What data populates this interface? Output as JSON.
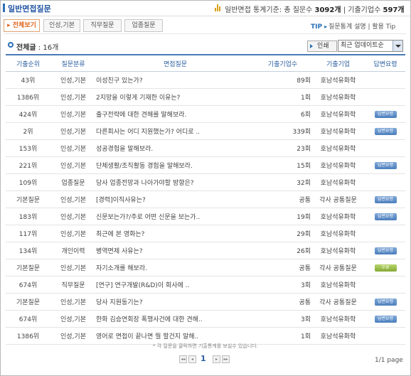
{
  "header": {
    "title": "일반면접질문",
    "stats_prefix": "일반면접 통계기준: 총 질문수",
    "total_questions": "3092개",
    "stats_mid": "| 기출기업수",
    "total_companies": "597개"
  },
  "tabs": [
    {
      "label": "전체보기",
      "active": true
    },
    {
      "label": "인성,기본",
      "active": false
    },
    {
      "label": "직무질문",
      "active": false
    },
    {
      "label": "업종질문",
      "active": false
    }
  ],
  "tip": {
    "label": "TIP",
    "text": "질문통계 설명 | 활용 Tip"
  },
  "total_label": "전체글",
  "total_count": ": 16개",
  "print_label": "인쇄",
  "sort_value": "최근 업데이트순",
  "columns": [
    "기출순위",
    "질문분류",
    "면접질문",
    "기출기업수",
    "기출기업",
    "답변요령"
  ],
  "rows": [
    {
      "rank": "43위",
      "category": "인성,기본",
      "question": "이성친구 있는가?",
      "count": "89회",
      "company": "호남석유화학",
      "answer": ""
    },
    {
      "rank": "1386위",
      "category": "인성,기본",
      "question": "2지망을 이렇게 기재한 이유는?",
      "count": "1회",
      "company": "호남석유화학",
      "answer": ""
    },
    {
      "rank": "424위",
      "category": "인성,기본",
      "question": "출구전략에 대한 견해를 말해보라.",
      "count": "6회",
      "company": "호남석유화학",
      "answer": "답변요령"
    },
    {
      "rank": "2위",
      "category": "인성,기본",
      "question": "다른회사는 어디 지원했는가? 어디로 ..",
      "count": "339회",
      "company": "호남석유화학",
      "answer": "답변요령"
    },
    {
      "rank": "153위",
      "category": "인성,기본",
      "question": "성공경험을 말해보라.",
      "count": "23회",
      "company": "호남석유화학",
      "answer": ""
    },
    {
      "rank": "221위",
      "category": "인성,기본",
      "question": "단체생활/조직활동 경험을 말해보라.",
      "count": "15회",
      "company": "호남석유화학",
      "answer": "답변요령"
    },
    {
      "rank": "109위",
      "category": "업종질문",
      "question": "당사 업종전망과 나아가야할 방향은?",
      "count": "32회",
      "company": "호남석유화학",
      "answer": ""
    },
    {
      "rank": "기본질문",
      "category": "인성,기본",
      "question": "[경력]이직사유는?",
      "count": "공통",
      "company": "각사 공통질문",
      "answer": "답변요령"
    },
    {
      "rank": "183위",
      "category": "인성,기본",
      "question": "신문보는가?/주로 어떤 신문을 보는가..",
      "count": "19회",
      "company": "호남석유화학",
      "answer": "답변요령"
    },
    {
      "rank": "117위",
      "category": "인성,기본",
      "question": "최근에 본 영화는?",
      "count": "29회",
      "company": "호남석유화학",
      "answer": ""
    },
    {
      "rank": "134위",
      "category": "개인이력",
      "question": "병역면제 사유는?",
      "count": "26회",
      "company": "호남석유화학",
      "answer": "답변요령"
    },
    {
      "rank": "기본질문",
      "category": "인성,기본",
      "question": "자기소개를 해보라.",
      "count": "공통",
      "company": "각사 공통질문",
      "answer": "무료"
    },
    {
      "rank": "674위",
      "category": "직무질문",
      "question": "[연구] 연구개발(R&D)이 회사에 ..",
      "count": "3회",
      "company": "호남석유화학",
      "answer": ""
    },
    {
      "rank": "기본질문",
      "category": "인성,기본",
      "question": "당사 지원동기는?",
      "count": "공통",
      "company": "각사 공통질문",
      "answer": "답변요령"
    },
    {
      "rank": "674위",
      "category": "인성,기본",
      "question": "한화 김승연회장 폭행사건에 대한 견해..",
      "count": "3회",
      "company": "호남석유화학",
      "answer": "답변요령"
    },
    {
      "rank": "1386위",
      "category": "인성,기본",
      "question": "영어로 면접이 끝나면 뭘 할건지 말해..",
      "count": "1회",
      "company": "호남석유화학",
      "answer": ""
    }
  ],
  "footnote": "* 각 질문을 클릭하면 기출통계를 보실수 있습니다.",
  "pager": {
    "current": "1",
    "info": "1/1 page"
  },
  "colors": {
    "accent": "#2b6fb8",
    "active_tab": "#e0661b",
    "badge": "#5b8cc8",
    "free_badge": "#95b843"
  }
}
